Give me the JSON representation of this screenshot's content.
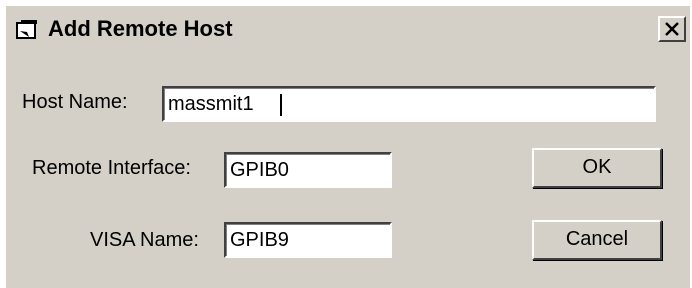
{
  "window": {
    "title": "Add Remote Host",
    "title_icon": "window-icon",
    "close_icon": "close-icon"
  },
  "form": {
    "host_name_label": "Host Name:",
    "host_name_value": "massmit1",
    "remote_interface_label": "Remote Interface:",
    "remote_interface_value": "GPIB0",
    "visa_name_label": "VISA Name:",
    "visa_name_value": "GPIB9"
  },
  "buttons": {
    "ok_label": "OK",
    "cancel_label": "Cancel"
  },
  "colors": {
    "dialog_background": "#d4d0c8",
    "field_background": "#ffffff"
  }
}
